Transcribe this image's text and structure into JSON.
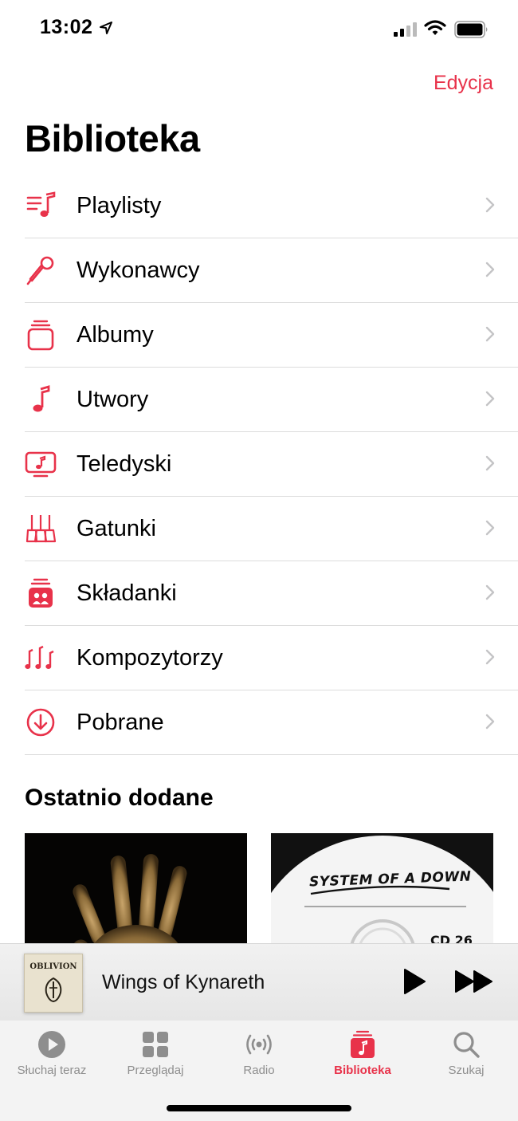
{
  "status_bar": {
    "time": "13:02"
  },
  "header": {
    "edit_label": "Edycja",
    "title": "Biblioteka"
  },
  "library_items": [
    {
      "label": "Playlisty",
      "icon": "playlist-icon"
    },
    {
      "label": "Wykonawcy",
      "icon": "microphone-icon"
    },
    {
      "label": "Albumy",
      "icon": "album-stack-icon"
    },
    {
      "label": "Utwory",
      "icon": "music-note-icon"
    },
    {
      "label": "Teledyski",
      "icon": "music-video-icon"
    },
    {
      "label": "Gatunki",
      "icon": "genres-icon"
    },
    {
      "label": "Składanki",
      "icon": "compilations-icon"
    },
    {
      "label": "Kompozytorzy",
      "icon": "composers-icon"
    },
    {
      "label": "Pobrane",
      "icon": "download-icon"
    }
  ],
  "recently_added": {
    "title": "Ostatnio dodane",
    "albums": [
      {
        "art_text": ""
      },
      {
        "art_text": "SYSTEM OF A DOWN",
        "art_subtext": "CD 26"
      }
    ]
  },
  "now_playing": {
    "title": "Wings of Kynareth",
    "art_text": "OBLIVION"
  },
  "tab_bar": {
    "tabs": [
      {
        "label": "Słuchaj teraz",
        "icon": "play-circle-icon"
      },
      {
        "label": "Przeglądaj",
        "icon": "grid-icon"
      },
      {
        "label": "Radio",
        "icon": "radio-icon"
      },
      {
        "label": "Biblioteka",
        "icon": "library-icon",
        "active": true
      },
      {
        "label": "Szukaj",
        "icon": "search-icon"
      }
    ]
  },
  "colors": {
    "accent": "#e8324a",
    "inactive": "#8e8e8e"
  }
}
